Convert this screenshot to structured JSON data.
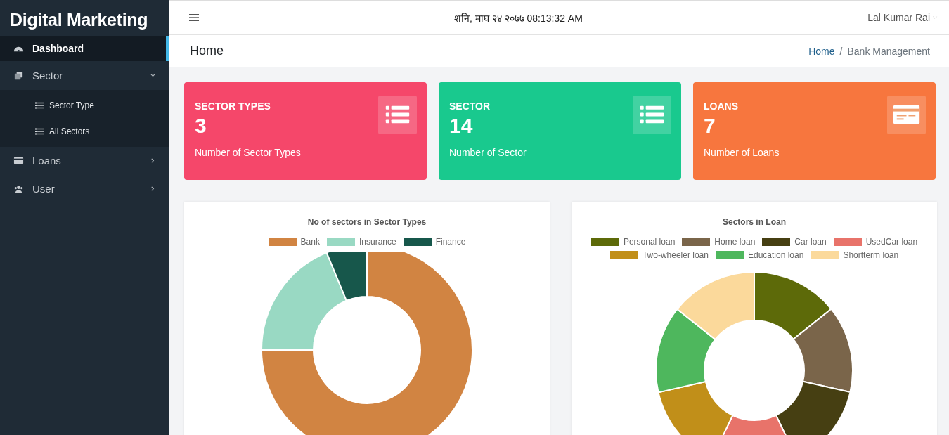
{
  "brand": "Digital Marketing",
  "sidebar": {
    "items": [
      {
        "label": "Dashboard",
        "selected": true
      },
      {
        "label": "Sector",
        "selected": false,
        "expanded": true,
        "children": [
          {
            "label": "Sector Type",
            "selected": false
          },
          {
            "label": "All Sectors",
            "selected": false
          }
        ]
      },
      {
        "label": "Loans",
        "selected": false,
        "expanded": false
      },
      {
        "label": "User",
        "selected": false,
        "expanded": false
      }
    ]
  },
  "header": {
    "datetime": "शनि, माघ २४ २०७७ 08:13:32 AM",
    "user": "Lal Kumar Rai"
  },
  "page_title": "Home",
  "breadcrumb": {
    "separator": "/",
    "items": [
      {
        "label": "Home",
        "kind": "link"
      },
      {
        "label": "Bank Management",
        "kind": "current"
      }
    ]
  },
  "stat_cards": [
    {
      "title": "SECTOR TYPES",
      "value": "3",
      "caption": "Number of Sector Types",
      "color": "#f5476a"
    },
    {
      "title": "SECTOR",
      "value": "14",
      "caption": "Number of Sector",
      "color": "#19c98e"
    },
    {
      "title": "LOANS",
      "value": "7",
      "caption": "Number of Loans",
      "color": "#f7763e"
    }
  ],
  "charts": [
    {
      "chart_data": {
        "type": "donut",
        "title": "No of sectors in Sector Types",
        "legend": "top",
        "categories": [
          "Bank",
          "Insurance",
          "Finance"
        ],
        "values": [
          75,
          18.75,
          6.25
        ],
        "colors": [
          "#d18442",
          "#99d9c3",
          "#17574b"
        ]
      }
    },
    {
      "chart_data": {
        "type": "donut",
        "title": "Sectors in Loan",
        "legend": "top",
        "categories": [
          "Personal loan",
          "Home loan",
          "Car loan",
          "UsedCar loan",
          "Two-wheeler loan",
          "Education loan",
          "Shortterm loan"
        ],
        "values": [
          14.28,
          14.28,
          14.28,
          14.28,
          14.28,
          14.28,
          14.32
        ],
        "colors": [
          "#5d6a09",
          "#7a654a",
          "#463f12",
          "#e8736a",
          "#c18f19",
          "#4eb75d",
          "#fbd99b"
        ]
      }
    }
  ]
}
